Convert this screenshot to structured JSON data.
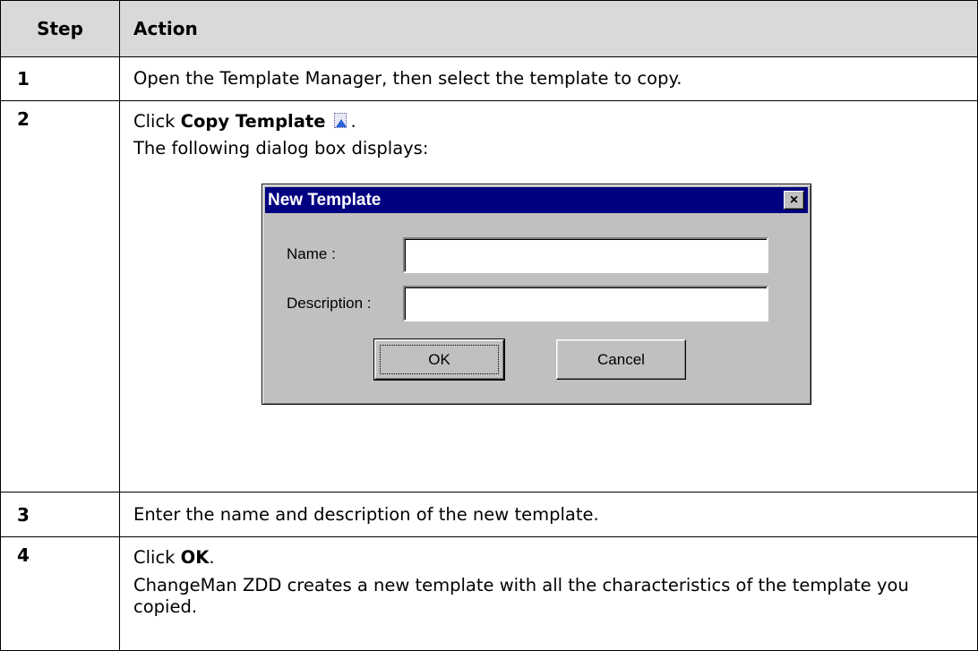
{
  "header": {
    "step": "Step",
    "action": "Action"
  },
  "steps": [
    {
      "num": "1",
      "text": "Open the Template Manager, then select the template to copy."
    },
    {
      "num": "2",
      "pre": "Click ",
      "bold": "Copy Template",
      "post": ".",
      "line2": "The following dialog box displays:"
    },
    {
      "num": "3",
      "text": "Enter the name and description of the new template."
    },
    {
      "num": "4",
      "pre": "Click ",
      "bold": "OK",
      "post": ".",
      "line2": "ChangeMan ZDD creates a new template with all the characteristics of the template you copied."
    }
  ],
  "dialog": {
    "title": "New Template",
    "close_glyph": "×",
    "name_label": "Name :",
    "name_value": "",
    "description_label": "Description :",
    "description_value": "",
    "ok_label": "OK",
    "cancel_label": "Cancel"
  },
  "icons": {
    "copy_template": "copy-template-icon"
  }
}
